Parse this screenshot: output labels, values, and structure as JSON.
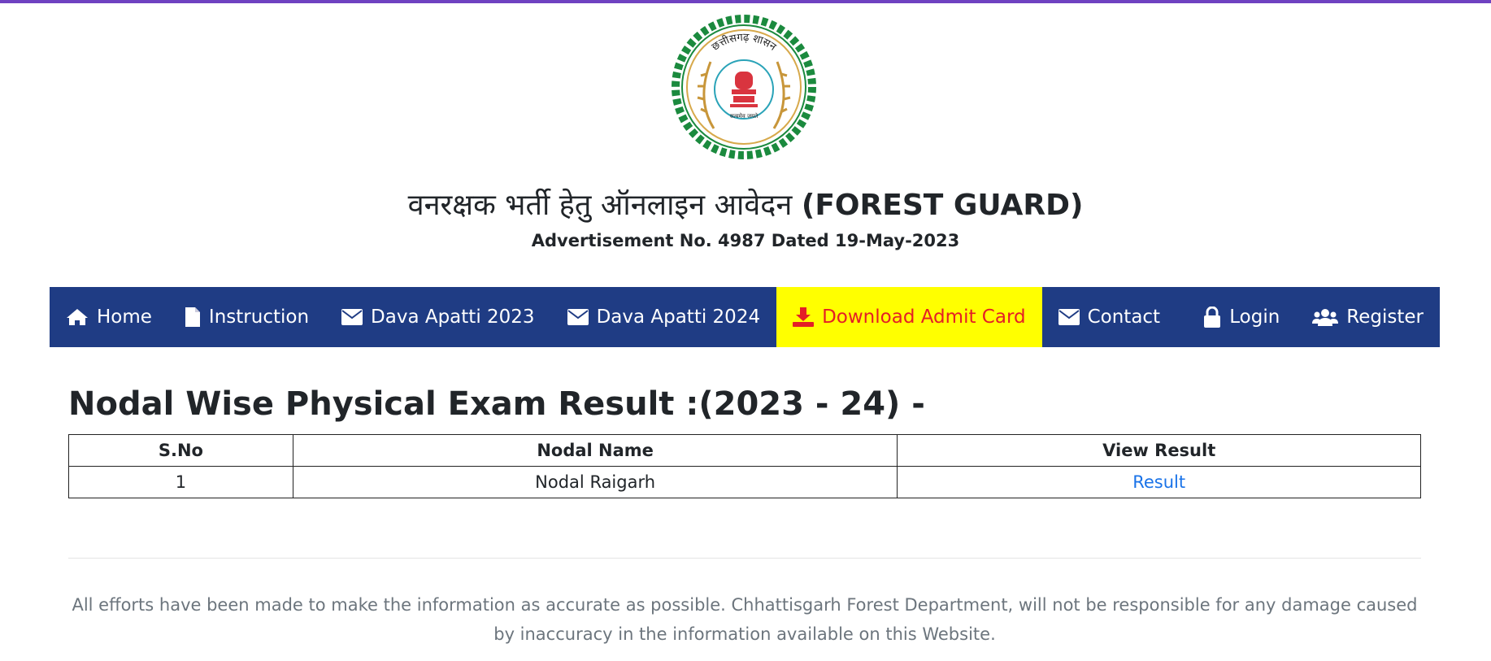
{
  "colors": {
    "top_border": "#6f42c1",
    "navbar": "#1f3c84",
    "highlight_bg": "#ffff00",
    "highlight_text": "#e41e26",
    "link": "#1a73e8"
  },
  "header": {
    "title_hindi": "वनरक्षक भर्ती हेतु ऑनलाइन आवेदन ",
    "title_english": "(FOREST GUARD)",
    "subtitle": "Advertisement No. 4987 Dated 19-May-2023",
    "emblem_icon": "chhattisgarh-government-emblem",
    "emblem_top_text": "छत्तीसगढ़ शासन",
    "emblem_bottom_text": "सत्यमेव जयते"
  },
  "nav": {
    "home": {
      "label": "Home",
      "icon": "home-icon"
    },
    "instruction": {
      "label": "Instruction",
      "icon": "file-icon"
    },
    "dava_2023": {
      "label": "Dava Apatti 2023",
      "icon": "envelope-icon"
    },
    "dava_2024": {
      "label": "Dava Apatti 2024",
      "icon": "envelope-icon"
    },
    "admit_card": {
      "label": "Download Admit Card",
      "icon": "download-icon"
    },
    "contact": {
      "label": "Contact",
      "icon": "envelope-icon"
    },
    "login": {
      "label": "Login",
      "icon": "lock-icon"
    },
    "register": {
      "label": "Register",
      "icon": "users-icon"
    }
  },
  "main": {
    "heading": "Nodal Wise Physical Exam Result :(2023 - 24) -",
    "table": {
      "headers": [
        "S.No",
        "Nodal Name",
        "View Result"
      ],
      "rows": [
        {
          "sno": "1",
          "nodal_name": "Nodal Raigarh",
          "result_link": "Result"
        }
      ]
    }
  },
  "footer": {
    "disclaimer": "All efforts have been made to make the information as accurate as possible. Chhattisgarh Forest Department, will not be responsible for any damage caused by inaccuracy in the information available on this Website."
  }
}
